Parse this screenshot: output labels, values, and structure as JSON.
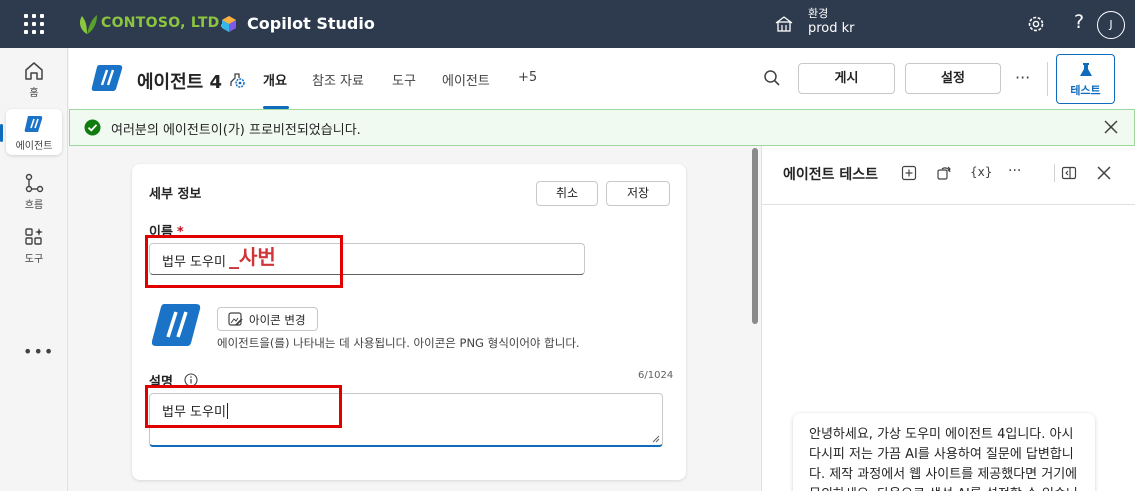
{
  "topbar": {
    "company": "CONTOSO, LTD.",
    "app_name": "Copilot Studio",
    "env_label": "환경",
    "env_value": "prod kr",
    "help": "?",
    "avatar_initial": "J"
  },
  "rail": {
    "items": [
      {
        "label": "홈",
        "icon": "home-icon"
      },
      {
        "label": "에이전트",
        "icon": "agents-icon"
      },
      {
        "label": "흐름",
        "icon": "flows-icon"
      },
      {
        "label": "도구",
        "icon": "tools-icon"
      }
    ],
    "more": "•••"
  },
  "header": {
    "title": "에이전트 4",
    "tabs": [
      "개요",
      "참조 자료",
      "도구",
      "에이전트",
      "+5"
    ],
    "publish": "게시",
    "settings": "설정",
    "more": "···",
    "test": "테스트"
  },
  "notification": {
    "text": "여러분의 에이전트이(가) 프로비전되었습니다.",
    "status_color": "#107c10"
  },
  "details": {
    "title": "세부 정보",
    "cancel": "취소",
    "save": "저장",
    "name_label": "이름",
    "name_required": "*",
    "name_value": "법무 도우미",
    "name_overlay": "_사번",
    "icon_change": "아이콘 변경",
    "icon_help": "에이전트을(를) 나타내는 데 사용됩니다. 아이콘은 PNG 형식이어야 합니다.",
    "desc_label": "설명",
    "desc_counter": "6/1024",
    "desc_value": "법무 도우미"
  },
  "test_panel": {
    "title": "에이전트 테스트",
    "var_label": "{x}",
    "more": "···",
    "message": "안녕하세요, 가상 도우미 에이전트 4입니다. 아시다시피 저는 가끔 AI를 사용하여 질문에 답변합니다. 제작 과정에서 웹 사이트를 제공했다면 거기에 문의하세요. 다음으로 생성 AI를 설정할 수 있습니다."
  },
  "colors": {
    "topbar": "#2e3b4e",
    "accent": "#0f6cbd",
    "brand_green": "#8cc63f",
    "highlight_red": "#e00000"
  }
}
